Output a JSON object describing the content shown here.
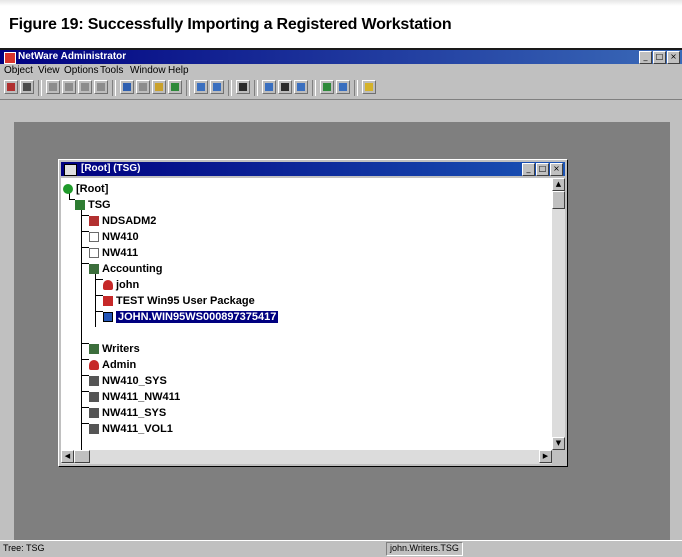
{
  "figure": {
    "title": "Figure 19: Successfully Importing a Registered Workstation"
  },
  "app": {
    "title": "NetWare Administrator",
    "window_buttons": [
      "_",
      "□",
      "×"
    ]
  },
  "menu": [
    "Object",
    "View",
    "Options",
    "Tools",
    "Window",
    "Help"
  ],
  "browser": {
    "title": "[Root] (TSG)",
    "window_buttons": [
      "_",
      "□",
      "×"
    ]
  },
  "tree": [
    {
      "label": "[Root]",
      "icon": "globe-icon",
      "color": "#1f9a2a"
    },
    {
      "label": "TSG",
      "icon": "organization-icon",
      "color": "#2e7d32"
    },
    {
      "label": "NDSADM2",
      "icon": "server-icon",
      "color": "#b23030"
    },
    {
      "label": "NW410",
      "icon": "server-icon",
      "color": "#6b6b6b"
    },
    {
      "label": "NW411",
      "icon": "server-icon",
      "color": "#6b6b6b"
    },
    {
      "label": "Accounting",
      "icon": "org-unit-icon",
      "color": "#3c6e3c"
    },
    {
      "label": "john",
      "icon": "user-icon",
      "color": "#c62828"
    },
    {
      "label": "TEST Win95 User Package",
      "icon": "policy-package-icon",
      "color": "#c62828"
    },
    {
      "label": "JOHN.WIN95WS000897375417",
      "icon": "workstation-icon",
      "color": "#2456b8",
      "selected": true
    },
    {
      "label": "Writers",
      "icon": "org-unit-icon",
      "color": "#3c6e3c"
    },
    {
      "label": "Admin",
      "icon": "user-icon",
      "color": "#c62828"
    },
    {
      "label": "NW410_SYS",
      "icon": "volume-icon",
      "color": "#555555"
    },
    {
      "label": "NW411_NW411",
      "icon": "volume-icon",
      "color": "#555555"
    },
    {
      "label": "NW411_SYS",
      "icon": "volume-icon",
      "color": "#555555"
    },
    {
      "label": "NW411_VOL1",
      "icon": "volume-icon",
      "color": "#555555"
    }
  ],
  "status": {
    "left": "Tree: TSG",
    "right": "john.Writers.TSG"
  },
  "colors": {
    "titlebar": "#000080",
    "workspace": "#7f7f7f",
    "chrome": "#c0c0c0",
    "selection": "#000080"
  }
}
